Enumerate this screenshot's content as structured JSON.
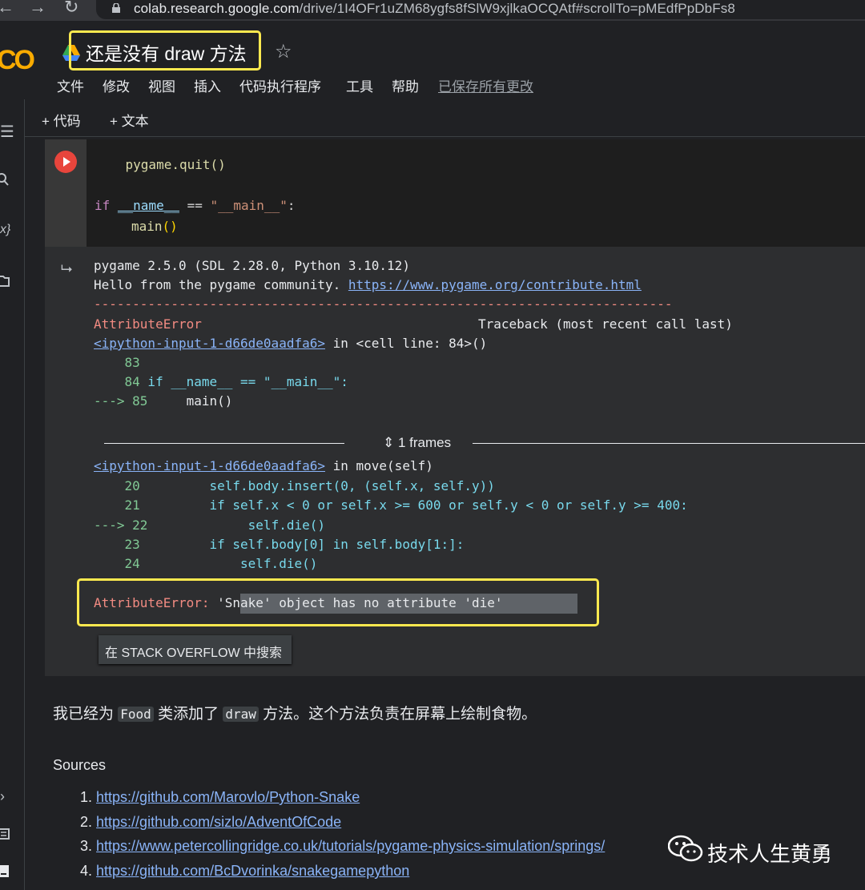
{
  "browser": {
    "url_host": "colab.research.google.com",
    "url_path": "/drive/1I4OFr1uZM68ygfs8fSlW9xjlkaOCQAtf#scrollTo=pMEdfPpDbFs8"
  },
  "header": {
    "title": "还是没有 draw 方法",
    "menu": [
      "文件",
      "修改",
      "视图",
      "插入",
      "代码执行程序",
      "工具",
      "帮助"
    ],
    "saved_status": "已保存所有更改"
  },
  "toolbar": {
    "add_code": "+ 代码",
    "add_text": "+ 文本"
  },
  "code": {
    "line1": "    pygame.quit()",
    "kw_if": "if",
    "name_var": "__name__",
    "eq": " == ",
    "main_str": "\"__main__\"",
    "colon": ":",
    "call": "main",
    "paren": "()"
  },
  "output": {
    "line1": "pygame 2.5.0 (SDL 2.28.0, Python 3.10.12)",
    "line2_prefix": "Hello from the pygame community. ",
    "line2_link": "https://www.pygame.org/contribute.html",
    "dashes": "---------------------------------------------------------------------------",
    "err_name": "AttributeError",
    "traceback_head": "Traceback (most recent call last)",
    "tb1_link": "<ipython-input-1-d66de0aadfa6>",
    "tb1_in": " in <cell line: 84>()",
    "tb1_lines": [
      {
        "arrow": "    ",
        "num": "83",
        "code": ""
      },
      {
        "arrow": "    ",
        "num": "84",
        "code": " if __name__ == \"__main__\":"
      },
      {
        "arrow": "---> ",
        "num": "85",
        "code": "     main()"
      }
    ],
    "frames": "1 frames",
    "tb2_link": "<ipython-input-1-d66de0aadfa6>",
    "tb2_in": " in move(self)",
    "tb2_lines": [
      {
        "arrow": "    ",
        "num": "20",
        "code": "         self.body.insert(0, (self.x, self.y))"
      },
      {
        "arrow": "    ",
        "num": "21",
        "code": "         if self.x < 0 or self.x >= 600 or self.y < 0 or self.y >= 400:"
      },
      {
        "arrow": "---> ",
        "num": "22",
        "code": "             self.die()"
      },
      {
        "arrow": "    ",
        "num": "23",
        "code": "         if self.body[0] in self.body[1:]:"
      },
      {
        "arrow": "    ",
        "num": "24",
        "code": "             self.die()"
      }
    ],
    "final_err_name": "AttributeError:",
    "final_err_msg": "'Snake' object has no attribute 'die'",
    "search_btn": "在 STACK OVERFLOW 中搜索"
  },
  "markdown": {
    "p1_a": "我已经为 ",
    "p1_chip1": "Food",
    "p1_b": " 类添加了 ",
    "p1_chip2": "draw",
    "p1_c": " 方法。这个方法负责在屏幕上绘制食物。",
    "sources_title": "Sources",
    "sources": [
      {
        "n": "1.",
        "url": "https://github.com/Marovlo/Python-Snake"
      },
      {
        "n": "2.",
        "url": "https://github.com/sizlo/AdventOfCode"
      },
      {
        "n": "3.",
        "url": "https://www.petercollingridge.co.uk/tutorials/pygame-physics-simulation/springs/"
      },
      {
        "n": "4.",
        "url": "https://github.com/BcDvorinka/snakegamepython"
      }
    ]
  },
  "watermark": {
    "text": "技术人生黄勇"
  }
}
